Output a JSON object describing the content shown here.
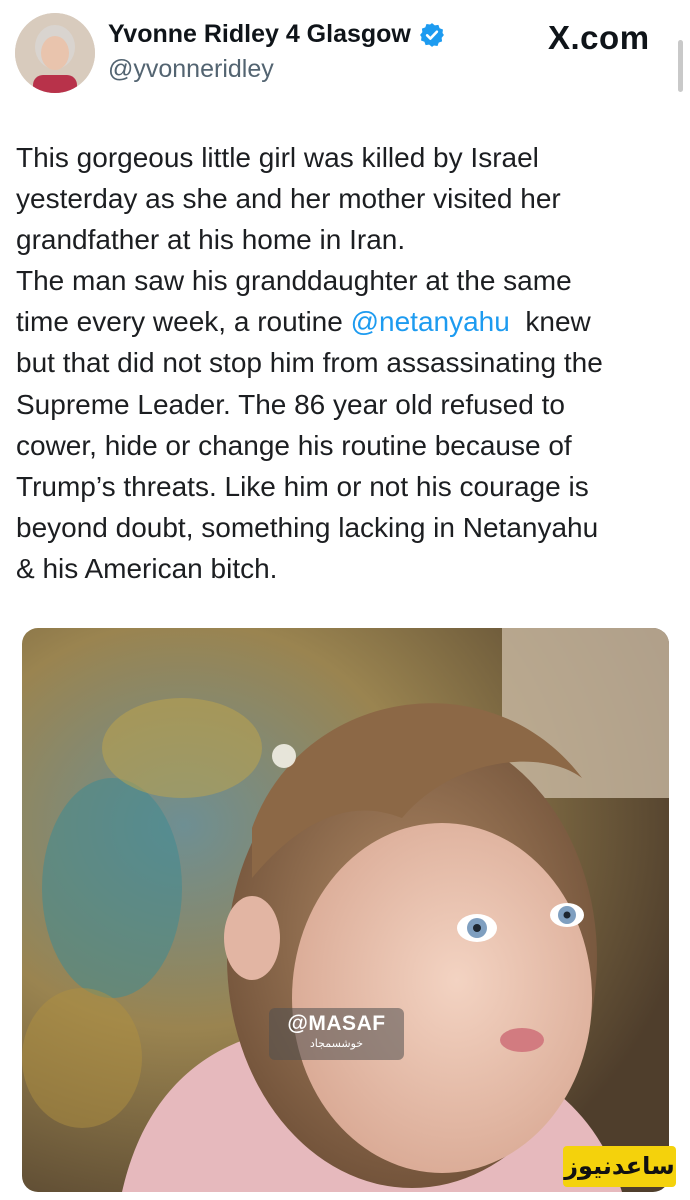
{
  "author": {
    "display_name": "Yvonne Ridley 4 Glasgow",
    "handle": "@yvonneridley",
    "verified_icon": "verified-badge-icon"
  },
  "site_label": "X.com",
  "tweet": {
    "line1": "This gorgeous little girl was killed by Israel",
    "line2": "yesterday as she and her mother visited her",
    "line3": "grandfather at his home in Iran.",
    "line4": "The man saw his granddaughter at the same",
    "line5_before": "time every week, a routine ",
    "line5_mention": "@netanyahu",
    "line5_after": "  knew",
    "line6": "but that did not stop him from assassinating the",
    "line7": "Supreme Leader. The 86 year old refused to",
    "line8": "cower, hide or change his routine because of",
    "line9": "Trump’s threats. Like him or not his courage is",
    "line10": "beyond doubt, something lacking in Netanyahu",
    "line11": "& his American bitch."
  },
  "photo": {
    "watermark_main": "@MASAF",
    "watermark_sub": "خوشسمجاد"
  },
  "corner_logo": "ساعدنیوز",
  "colors": {
    "mention": "#1d9bf0",
    "verified": "#1d9bf0",
    "logo_bg": "#f4d20c"
  }
}
